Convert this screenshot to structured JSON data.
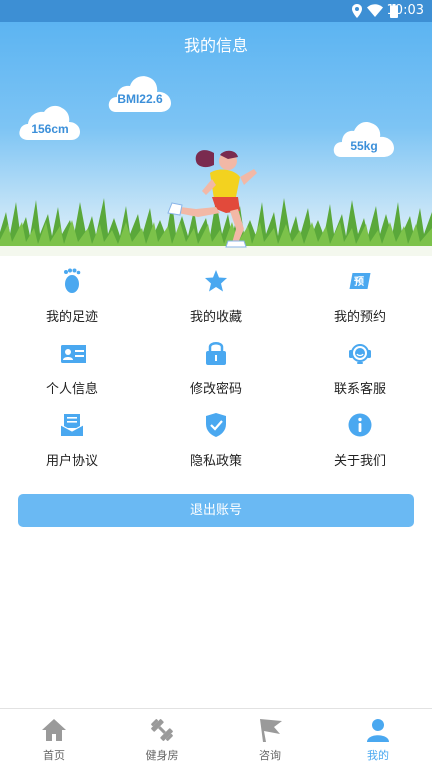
{
  "status": {
    "time": "10:03"
  },
  "header": {
    "title": "我的信息"
  },
  "stats": {
    "height": "156cm",
    "bmi": "BMI22.6",
    "weight": "55kg"
  },
  "menu": [
    {
      "label": "我的足迹",
      "icon": "footprint-icon"
    },
    {
      "label": "我的收藏",
      "icon": "star-icon"
    },
    {
      "label": "我的预约",
      "icon": "appointment-icon",
      "badge": "预"
    },
    {
      "label": "个人信息",
      "icon": "id-card-icon"
    },
    {
      "label": "修改密码",
      "icon": "lock-icon"
    },
    {
      "label": "联系客服",
      "icon": "headset-icon"
    },
    {
      "label": "用户协议",
      "icon": "agreement-icon"
    },
    {
      "label": "隐私政策",
      "icon": "shield-check-icon"
    },
    {
      "label": "关于我们",
      "icon": "info-icon"
    }
  ],
  "logout": {
    "label": "退出账号"
  },
  "tabs": [
    {
      "label": "首页",
      "icon": "home-icon"
    },
    {
      "label": "健身房",
      "icon": "dumbbell-icon"
    },
    {
      "label": "咨询",
      "icon": "flag-icon"
    },
    {
      "label": "我的",
      "icon": "user-icon"
    }
  ],
  "colors": {
    "accent": "#4aa8f0",
    "statusbar": "#3d8fd4",
    "button": "#6ab9f3",
    "inactive": "#9a9a9a"
  }
}
